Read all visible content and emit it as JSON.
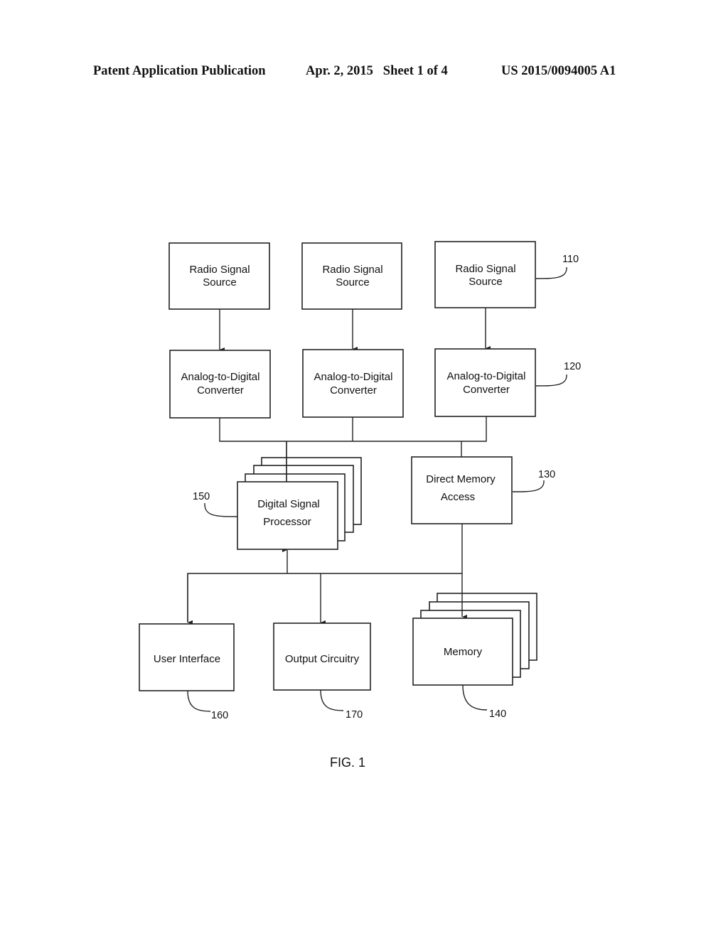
{
  "header": {
    "publication": "Patent Application Publication",
    "date_sheet": "Apr. 2, 2015   Sheet 1 of 4",
    "number": "US 2015/0094005 A1"
  },
  "diagram": {
    "nodes": {
      "radio1": {
        "lines": [
          "Radio Signal",
          "Source"
        ]
      },
      "radio2": {
        "lines": [
          "Radio Signal",
          "Source"
        ]
      },
      "radio3": {
        "lines": [
          "Radio Signal",
          "Source"
        ],
        "ref": "110"
      },
      "adc1": {
        "lines": [
          "Analog-to-Digital",
          "Converter"
        ]
      },
      "adc2": {
        "lines": [
          "Analog-to-Digital",
          "Converter"
        ]
      },
      "adc3": {
        "lines": [
          "Analog-to-Digital",
          "Converter"
        ],
        "ref": "120"
      },
      "dma": {
        "lines": [
          "Direct Memory",
          "Access"
        ],
        "ref": "130"
      },
      "memory": {
        "lines": [
          "Memory"
        ],
        "ref": "140"
      },
      "dsp": {
        "lines": [
          "Digital Signal",
          "Processor"
        ],
        "ref": "150"
      },
      "ui": {
        "lines": [
          "User Interface"
        ],
        "ref": "160"
      },
      "output": {
        "lines": [
          "Output Circuitry"
        ],
        "ref": "170"
      }
    },
    "edges": [
      {
        "from": "radio1",
        "to": "adc1",
        "arrow": "forward"
      },
      {
        "from": "radio2",
        "to": "adc2",
        "arrow": "forward"
      },
      {
        "from": "radio3",
        "to": "adc3",
        "arrow": "forward"
      },
      {
        "from": "adc1",
        "to": "bus-top",
        "arrow": "none"
      },
      {
        "from": "adc2",
        "to": "bus-top",
        "arrow": "none"
      },
      {
        "from": "adc3",
        "to": "bus-top",
        "arrow": "none"
      },
      {
        "from": "bus-top",
        "to": "dsp",
        "arrow": "none"
      },
      {
        "from": "bus-top",
        "to": "dma",
        "arrow": "none"
      },
      {
        "from": "dma",
        "to": "bus-bottom",
        "arrow": "none"
      },
      {
        "from": "bus-bottom",
        "to": "dsp",
        "arrow": "forward"
      },
      {
        "from": "bus-bottom",
        "to": "ui",
        "arrow": "forward"
      },
      {
        "from": "bus-bottom",
        "to": "output",
        "arrow": "forward"
      },
      {
        "from": "dma",
        "to": "memory",
        "arrow": "forward"
      }
    ],
    "caption": "FIG. 1"
  }
}
